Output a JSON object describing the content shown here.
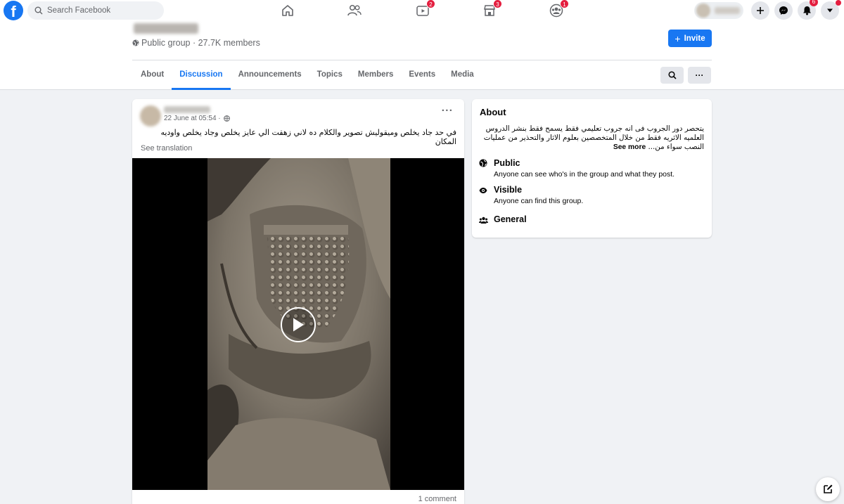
{
  "search": {
    "placeholder": "Search Facebook"
  },
  "nav": {
    "watch_badge": "2",
    "marketplace_badge": "3",
    "groups_badge": "1",
    "notifications_badge": "6"
  },
  "group": {
    "meta": "Public group · 27.7K members",
    "invite_label": "Invite",
    "tabs": [
      "About",
      "Discussion",
      "Announcements",
      "Topics",
      "Members",
      "Events",
      "Media"
    ],
    "active_tab": "Discussion"
  },
  "post": {
    "timestamp": "22 June at 05:54 ·",
    "text": "في حد جاد يخلص وميقوليش تصوير والكلام ده لاني زهقت الي عايز يخلص وجاد يخلص واوديه المكان",
    "see_translation": "See translation",
    "comment_count": "1 comment",
    "more_label": "···"
  },
  "about": {
    "title": "About",
    "description": "يتحصر دور الجروب فى انه جروب تعليمي فقط يسمح فقط بنشر الدروس العلميه الاثريه فقط من خلال المتخصصين بعلوم الاثار والتحذير من عمليات النصب سواء من...",
    "see_more": "See more",
    "rows": [
      {
        "icon": "globe-icon",
        "title": "Public",
        "subtitle": "Anyone can see who's in the group and what they post."
      },
      {
        "icon": "eye-icon",
        "title": "Visible",
        "subtitle": "Anyone can find this group."
      },
      {
        "icon": "people-icon",
        "title": "General",
        "subtitle": ""
      }
    ]
  },
  "colors": {
    "brand": "#1877f2",
    "badge": "#e41e3f",
    "page_bg": "#f0f2f5"
  }
}
